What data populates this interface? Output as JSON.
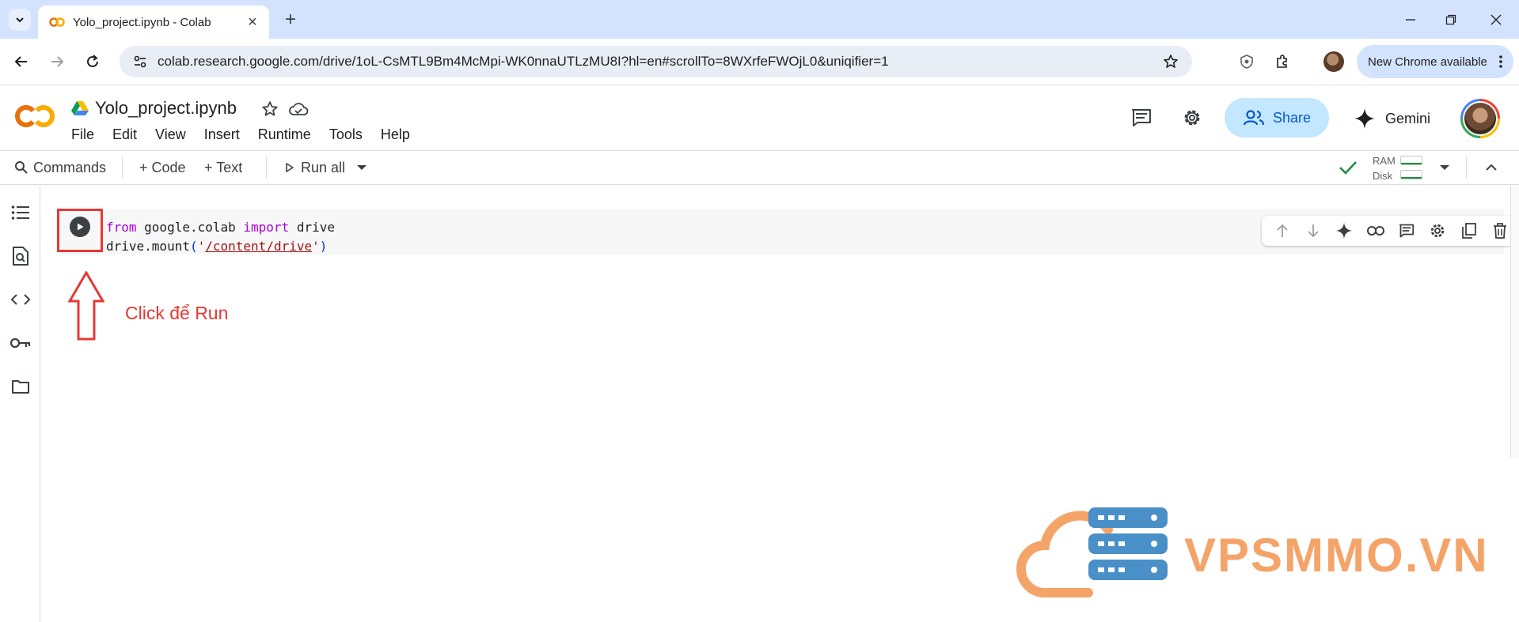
{
  "browser": {
    "tab_title": "Yolo_project.ipynb - Colab",
    "url": "colab.research.google.com/drive/1oL-CsMTL9Bm4McMpi-WK0nnaUTLzMU8I?hl=en#scrollTo=8WXrfeFWOjL0&uniqifier=1",
    "new_chrome_label": "New Chrome available"
  },
  "colab": {
    "notebook_title": "Yolo_project.ipynb",
    "menu": [
      "File",
      "Edit",
      "View",
      "Insert",
      "Runtime",
      "Tools",
      "Help"
    ],
    "share_label": "Share",
    "gemini_label": "Gemini"
  },
  "toolbar": {
    "commands_label": "Commands",
    "code_label": "+ Code",
    "text_label": "+ Text",
    "run_all_label": "Run all",
    "ram_label": "RAM",
    "disk_label": "Disk"
  },
  "cell": {
    "line1": {
      "kw1": "from",
      "mod": " google.colab ",
      "kw2": "import",
      "name": " drive"
    },
    "line2": {
      "prefix": "drive.mount",
      "open": "(",
      "q1": "'",
      "path": "/content/drive",
      "q2": "'",
      "close": ")"
    }
  },
  "annotation": {
    "text": "Click để Run",
    "color": "#e53935"
  },
  "watermark": {
    "text": "VPSMMO.VN",
    "color": "#f4a469",
    "accent": "#4a90c8"
  },
  "colors": {
    "tabstrip": "#d3e3fd",
    "share_bg": "#c2e7ff",
    "share_text": "#0b57d0",
    "keyword": "#af00db",
    "string": "#a31515",
    "status_ok": "#1e8e3e"
  }
}
